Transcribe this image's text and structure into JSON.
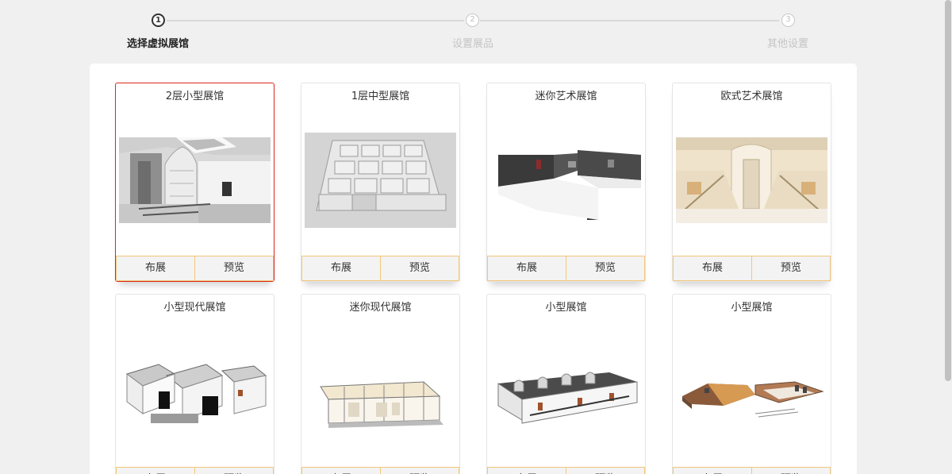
{
  "stepper": {
    "steps": [
      {
        "number": "1",
        "label": "选择虚拟展馆",
        "active": true
      },
      {
        "number": "2",
        "label": "设置展品",
        "active": false
      },
      {
        "number": "3",
        "label": "其他设置",
        "active": false
      }
    ]
  },
  "gallery": {
    "cards": [
      {
        "title": "2层小型展馆",
        "image": "two-floor-hall-interior",
        "btn_arrange": "布展",
        "btn_preview": "预览",
        "selected": true
      },
      {
        "title": "1层中型展馆",
        "image": "one-floor-medium-hall-model",
        "btn_arrange": "布展",
        "btn_preview": "预览"
      },
      {
        "title": "迷你艺术展馆",
        "image": "mini-art-hall-model",
        "btn_arrange": "布展",
        "btn_preview": "预览"
      },
      {
        "title": "欧式艺术展馆",
        "image": "european-art-hall-interior",
        "btn_arrange": "布展",
        "btn_preview": "预览"
      },
      {
        "title": "小型现代展馆",
        "image": "small-modern-hall-model",
        "btn_arrange": "布展",
        "btn_preview": "预览"
      },
      {
        "title": "迷你现代展馆",
        "image": "mini-modern-hall-model",
        "btn_arrange": "布展",
        "btn_preview": "预览"
      },
      {
        "title": "小型展馆",
        "image": "small-hall-model-a",
        "btn_arrange": "布展",
        "btn_preview": "预览"
      },
      {
        "title": "小型展馆",
        "image": "small-hall-model-b",
        "btn_arrange": "布展",
        "btn_preview": "预览"
      }
    ]
  },
  "colors": {
    "selected_border": "#d9281c",
    "button_border": "#f2c77a",
    "page_background": "#f0f0f0"
  }
}
